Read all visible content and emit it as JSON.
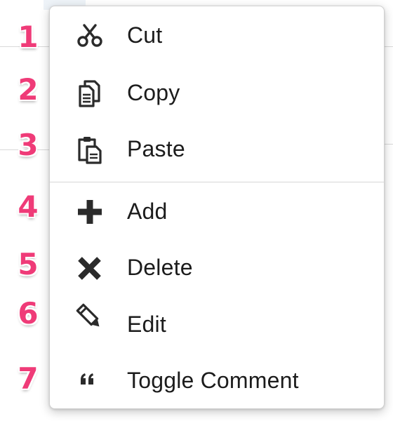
{
  "context_menu": {
    "items": [
      {
        "number": "1",
        "label": "Cut",
        "icon": "scissors-icon"
      },
      {
        "number": "2",
        "label": "Copy",
        "icon": "copy-icon"
      },
      {
        "number": "3",
        "label": "Paste",
        "icon": "paste-icon"
      },
      {
        "number": "4",
        "label": "Add",
        "icon": "plus-icon"
      },
      {
        "number": "5",
        "label": "Delete",
        "icon": "close-icon"
      },
      {
        "number": "6",
        "label": "Edit",
        "icon": "pencil-icon"
      },
      {
        "number": "7",
        "label": "Toggle Comment",
        "icon": "quote-icon"
      }
    ]
  },
  "colors": {
    "badge": "#ef3b78",
    "icon": "#2b2b2b",
    "text": "#1c1c1c"
  }
}
